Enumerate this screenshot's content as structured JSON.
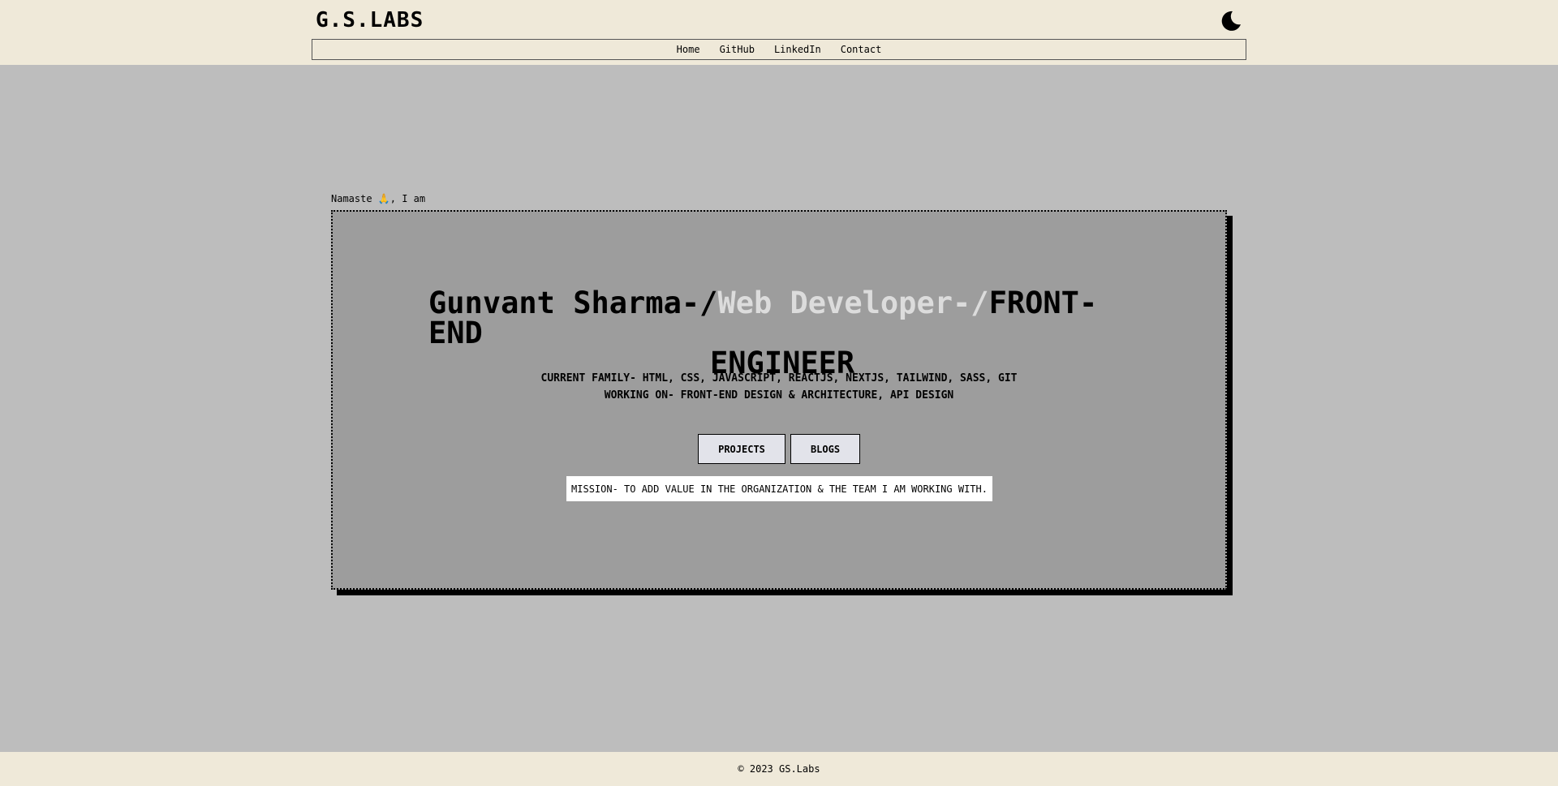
{
  "header": {
    "logo": "G.S.LABS",
    "theme_toggle_icon": "moon-icon",
    "nav": [
      "Home",
      "GitHub",
      "LinkedIn",
      "Contact"
    ]
  },
  "hero": {
    "greeting_prefix": "Namaste ",
    "greeting_emoji": "🙏",
    "greeting_suffix": ", I am",
    "name": "Gunvant Sharma-/",
    "role": "Web Developer-/",
    "title_line1_end": "FRONT-END",
    "title_line2": "ENGINEER",
    "current_family": "CURRENT FAMILY- HTML, CSS, JAVASCRIPT, REACTJS, NEXTJS, TAILWIND, SASS, GIT",
    "working_on": "WORKING ON- FRONT-END DESIGN & ARCHITECTURE, API DESIGN",
    "buttons": [
      "PROJECTS",
      "BLOGS"
    ],
    "mission": "MISSION- TO ADD VALUE IN THE ORGANIZATION & THE TEAM I AM WORKING WITH."
  },
  "footer": {
    "copyright": "© 2023 GS.Labs"
  },
  "colors": {
    "header_bg": "#efe9d9",
    "page_bg": "#bdbdbd",
    "hero_bg": "#9d9d9d",
    "role_text": "#dcdcdc"
  }
}
